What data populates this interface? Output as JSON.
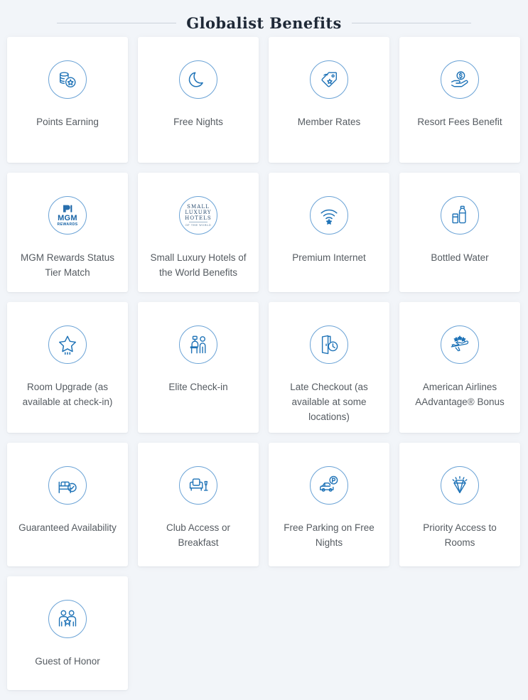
{
  "header": {
    "title": "Globalist Benefits",
    "rule_color": "#ccd2da"
  },
  "theme": {
    "page_background": "#f2f5f9",
    "card_background": "#ffffff",
    "icon_accent": "#1f73b7",
    "icon_circle_border": "#6ba3d6",
    "label_text": "#555b61",
    "title_text": "#1f2937"
  },
  "benefits": [
    {
      "label": "Points Earning",
      "icon": "coins-star-icon"
    },
    {
      "label": "Free Nights",
      "icon": "crescent-moon-icon"
    },
    {
      "label": "Member Rates",
      "icon": "price-tag-star-icon"
    },
    {
      "label": "Resort Fees Benefit",
      "icon": "hand-dollar-coin-icon"
    },
    {
      "label": "MGM Rewards Status Tier Match",
      "icon": "mgm-rewards-logo-icon",
      "logo": {
        "word": "MGM",
        "sub": "REWARDS"
      }
    },
    {
      "label": "Small Luxury Hotels of the World Benefits",
      "icon": "small-luxury-hotels-logo-icon",
      "logo": {
        "line1": "SMALL",
        "line2": "LUXURY",
        "line3": "HOTELS",
        "sub": "OF THE WORLD"
      }
    },
    {
      "label": "Premium Internet",
      "icon": "wifi-star-icon"
    },
    {
      "label": "Bottled Water",
      "icon": "water-bottle-glass-icon"
    },
    {
      "label": "Room Upgrade (as available at check-in)",
      "icon": "star-upgrade-icon"
    },
    {
      "label": "Elite Check-in",
      "icon": "check-in-desk-icon"
    },
    {
      "label": "Late Checkout (as available at some locations)",
      "icon": "door-clock-icon"
    },
    {
      "label": "American Airlines AAdvantage® Bonus",
      "icon": "airplane-stars-icon"
    },
    {
      "label": "Guaranteed Availability",
      "icon": "bed-check-icon"
    },
    {
      "label": "Club Access or Breakfast",
      "icon": "armchair-lamp-icon"
    },
    {
      "label": "Free Parking on Free Nights",
      "icon": "car-parking-icon"
    },
    {
      "label": "Priority Access to Rooms",
      "icon": "diamond-sparkle-icon"
    },
    {
      "label": "Guest of Honor",
      "icon": "two-people-star-icon"
    }
  ]
}
